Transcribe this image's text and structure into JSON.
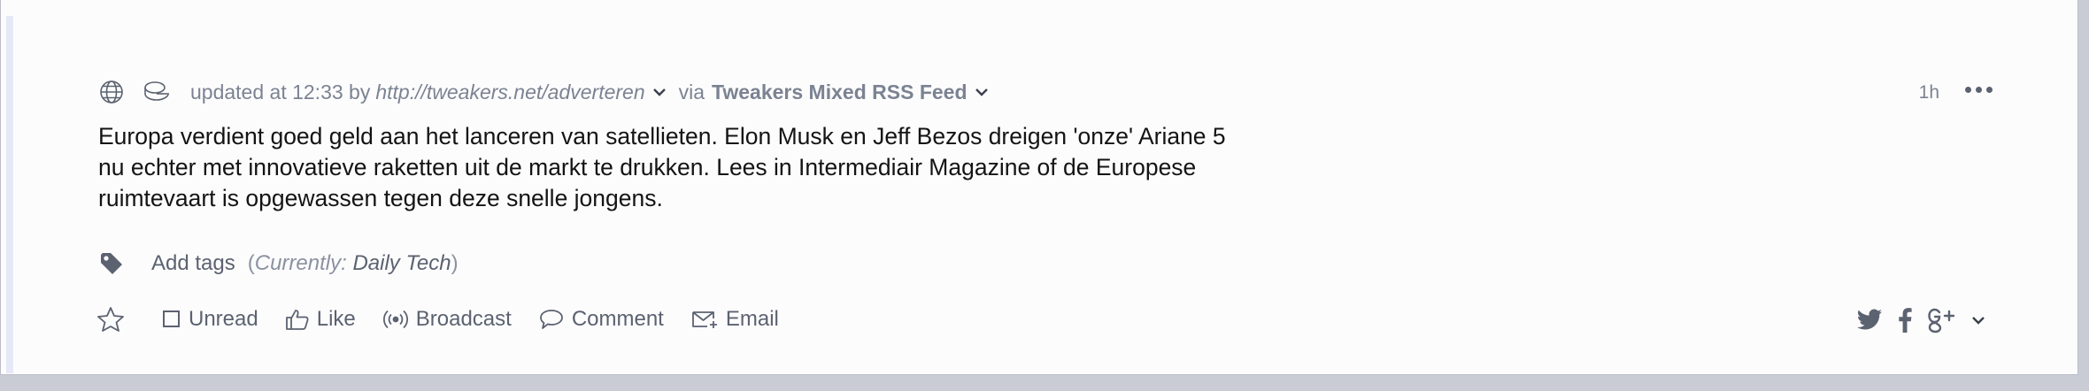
{
  "item": {
    "updated_label": "updated at 12:33 by",
    "author": "http://tweakers.net/adverteren",
    "via_label": "via",
    "feed_name": "Tweakers Mixed RSS Feed",
    "age": "1h",
    "content": "Europa verdient goed geld aan het lanceren van satellieten. Elon Musk en Jeff Bezos dreigen 'onze' Ariane 5 nu echter met innovatieve raketten uit de markt te drukken. Lees in Intermediair Magazine of de Europese ruimtevaart is opgewassen tegen deze snelle jongens."
  },
  "tags": {
    "add_label": "Add tags",
    "open_paren": "(",
    "currently_label": "Currently:",
    "current_value": "Daily Tech",
    "close_paren": ")"
  },
  "actions": {
    "unread": "Unread",
    "like": "Like",
    "broadcast": "Broadcast",
    "comment": "Comment",
    "email": "Email"
  },
  "icons": [
    "globe-icon",
    "feed-icon",
    "chevron-down-icon",
    "more-icon",
    "tag-icon",
    "star-icon",
    "checkbox-icon",
    "thumbs-up-icon",
    "broadcast-icon",
    "comment-icon",
    "email-icon",
    "twitter-icon",
    "facebook-icon",
    "google-plus-icon"
  ],
  "colors": {
    "background": "#c9ccd4",
    "card": "#fdfcfd",
    "accent_bar": "#e4e8f7",
    "muted_text": "#7b8392",
    "action_text": "#5b6270",
    "body_text": "#141414"
  }
}
